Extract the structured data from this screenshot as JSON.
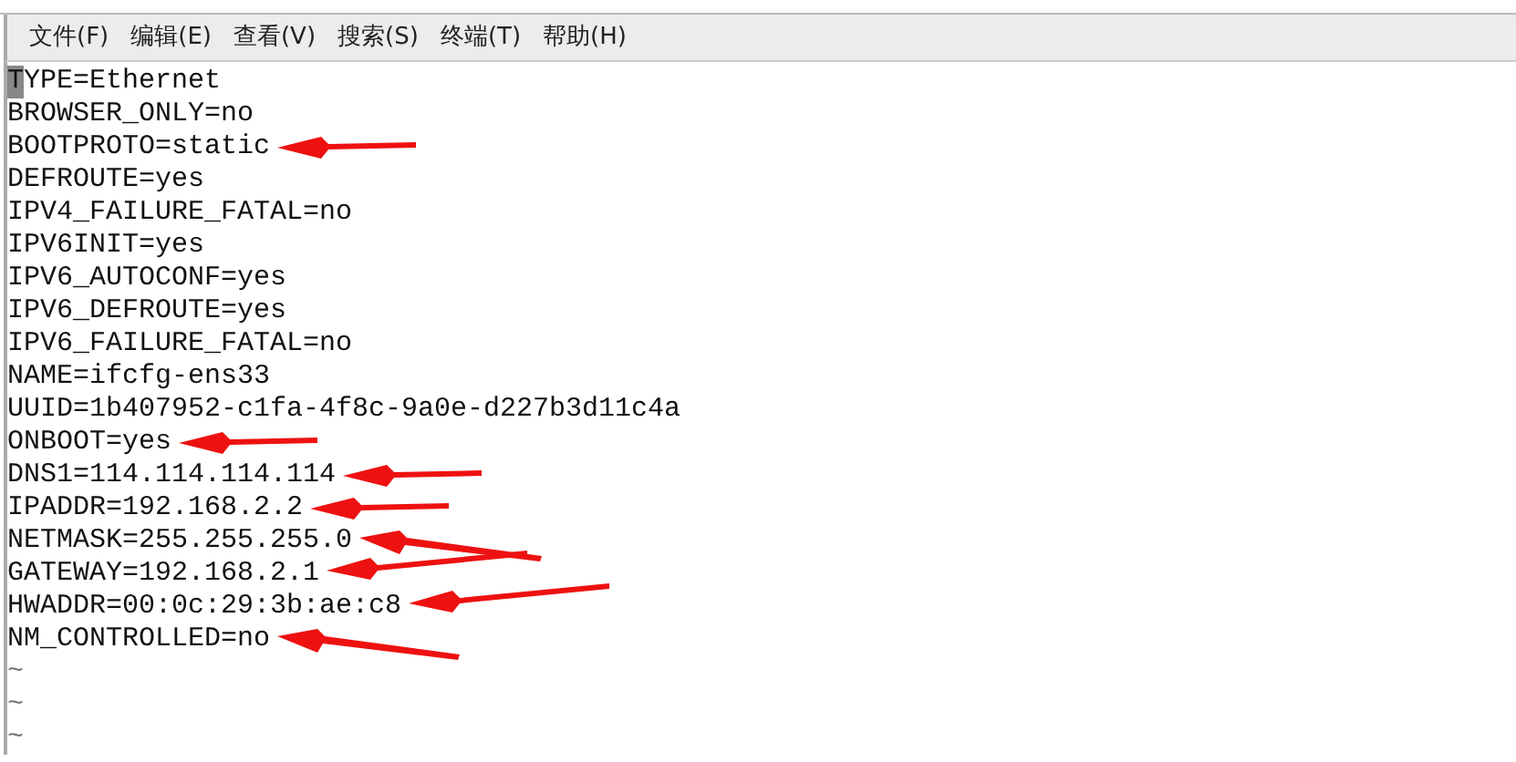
{
  "menu": [
    {
      "label": "文件(F)"
    },
    {
      "label": "编辑(E)"
    },
    {
      "label": "查看(V)"
    },
    {
      "label": "搜索(S)"
    },
    {
      "label": "终端(T)"
    },
    {
      "label": "帮助(H)"
    }
  ],
  "lines": [
    {
      "text": "TYPE=Ethernet",
      "kind": "plain",
      "cursor": true
    },
    {
      "text": "BROWSER_ONLY=no",
      "kind": "plain"
    },
    {
      "text": "BOOTPROTO=static",
      "kind": "flat"
    },
    {
      "text": "DEFROUTE=yes",
      "kind": "plain"
    },
    {
      "text": "IPV4_FAILURE_FATAL=no",
      "kind": "plain"
    },
    {
      "text": "IPV6INIT=yes",
      "kind": "plain"
    },
    {
      "text": "IPV6_AUTOCONF=yes",
      "kind": "plain"
    },
    {
      "text": "IPV6_DEFROUTE=yes",
      "kind": "plain"
    },
    {
      "text": "IPV6_FAILURE_FATAL=no",
      "kind": "plain"
    },
    {
      "text": "NAME=ifcfg-ens33",
      "kind": "plain"
    },
    {
      "text": "UUID=1b407952-c1fa-4f8c-9a0e-d227b3d11c4a",
      "kind": "plain"
    },
    {
      "text": "ONBOOT=yes",
      "kind": "flat"
    },
    {
      "text": "DNS1=114.114.114.114",
      "kind": "flat"
    },
    {
      "text": "IPADDR=192.168.2.2",
      "kind": "flat"
    },
    {
      "text": "NETMASK=255.255.255.0",
      "kind": "down"
    },
    {
      "text": "GATEWAY=192.168.2.1",
      "kind": "up"
    },
    {
      "text": "HWADDR=00:0c:29:3b:ae:c8",
      "kind": "up"
    },
    {
      "text": "NM_CONTROLLED=no",
      "kind": "down"
    },
    {
      "text": "~",
      "kind": "empty"
    },
    {
      "text": "~",
      "kind": "empty"
    },
    {
      "text": "~",
      "kind": "empty"
    }
  ]
}
